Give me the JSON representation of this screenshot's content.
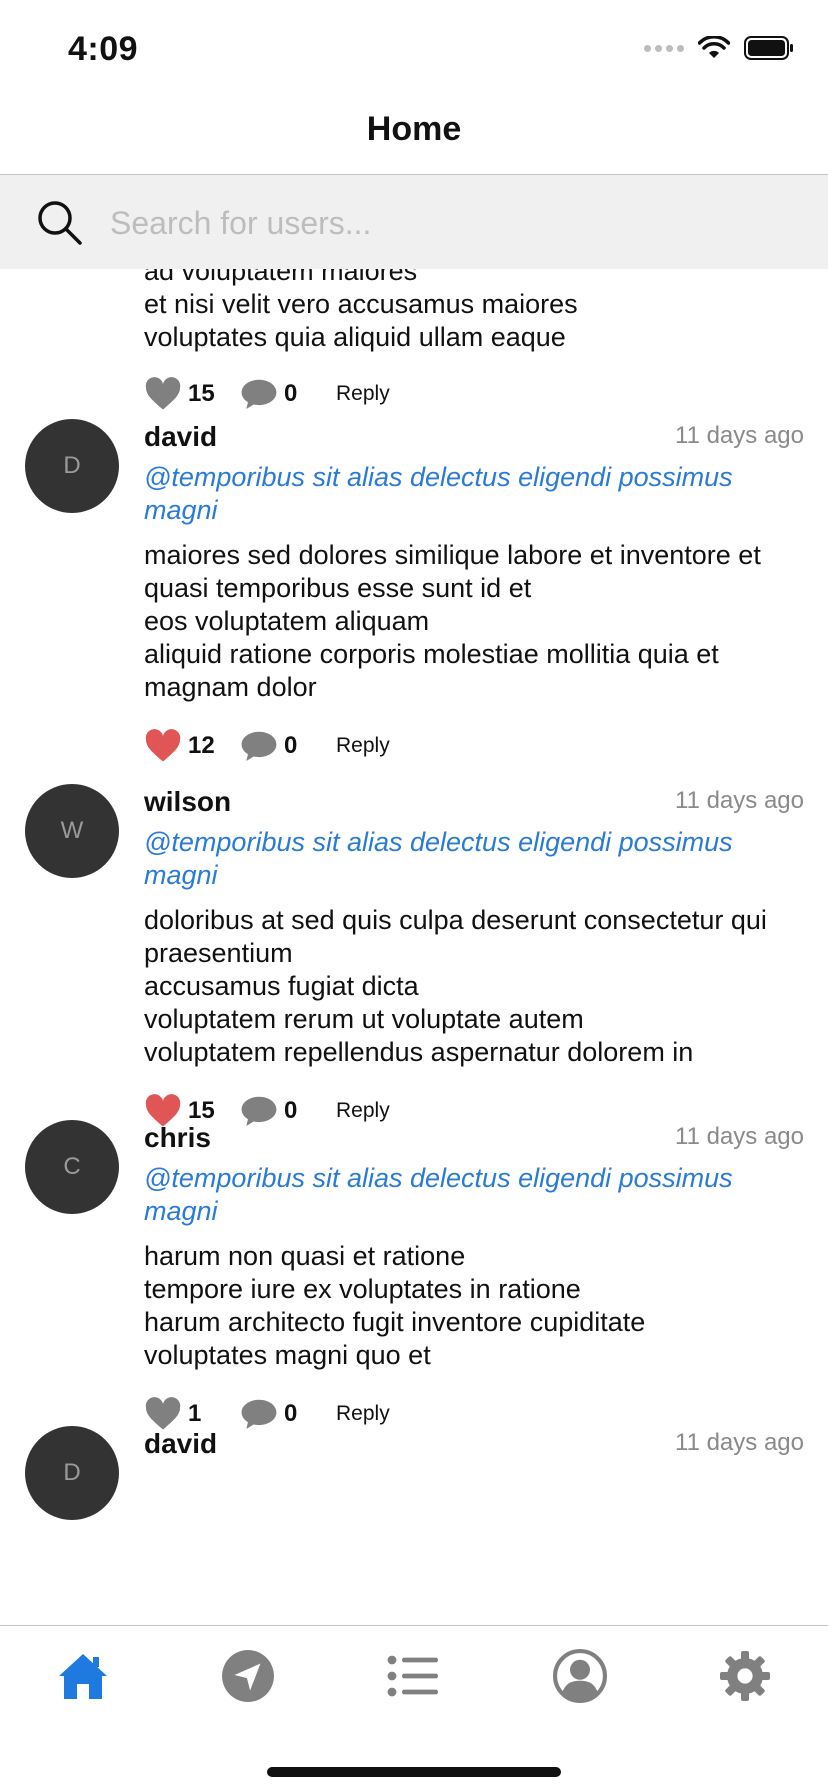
{
  "status_bar": {
    "time": "4:09"
  },
  "header": {
    "title": "Home"
  },
  "search": {
    "placeholder": "Search for users..."
  },
  "feed": {
    "partial_top": {
      "body": "ad voluptatem maiores\net nisi velit vero accusamus maiores\nvoluptates quia aliquid ullam eaque",
      "likes": "15",
      "liked": false,
      "comments": "0",
      "reply_label": "Reply"
    },
    "items": [
      {
        "avatar_letter": "D",
        "username": "david",
        "timestamp": "11 days ago",
        "mention": "@temporibus sit alias delectus eligendi possimus magni",
        "body": "maiores sed dolores similique labore et inventore et\nquasi temporibus esse sunt id et\neos voluptatem aliquam\naliquid ratione corporis molestiae mollitia quia et magnam dolor",
        "likes": "12",
        "liked": true,
        "comments": "0",
        "reply_label": "Reply"
      },
      {
        "avatar_letter": "W",
        "username": "wilson",
        "timestamp": "11 days ago",
        "mention": "@temporibus sit alias delectus eligendi possimus magni",
        "body": "doloribus at sed quis culpa deserunt consectetur qui praesentium\naccusamus fugiat dicta\nvoluptatem rerum ut voluptate autem\nvoluptatem repellendus aspernatur dolorem in",
        "likes": "15",
        "liked": true,
        "comments": "0",
        "reply_label": "Reply"
      },
      {
        "avatar_letter": "C",
        "username": "chris",
        "timestamp": "11 days ago",
        "mention": "@temporibus sit alias delectus eligendi possimus magni",
        "body": "harum non quasi et ratione\ntempore iure ex voluptates in ratione\nharum architecto fugit inventore cupiditate\nvoluptates magni quo et",
        "likes": "1",
        "liked": false,
        "comments": "0",
        "reply_label": "Reply"
      },
      {
        "avatar_letter": "D",
        "username": "david",
        "timestamp": "11 days ago",
        "mention": "",
        "body": "",
        "likes": "",
        "liked": false,
        "comments": "",
        "reply_label": ""
      }
    ]
  },
  "tab_bar": {
    "tabs": [
      {
        "icon": "home-icon",
        "active": true
      },
      {
        "icon": "navigation-icon",
        "active": false
      },
      {
        "icon": "list-icon",
        "active": false
      },
      {
        "icon": "profile-icon",
        "active": false
      },
      {
        "icon": "gear-icon",
        "active": false
      }
    ]
  },
  "colors": {
    "accent": "#1f7ae0",
    "mention": "#2a7bd6",
    "liked_heart": "#e05555",
    "inactive_icon": "#808080",
    "avatar_bg": "#333333",
    "search_bg": "#f0f0f0"
  }
}
